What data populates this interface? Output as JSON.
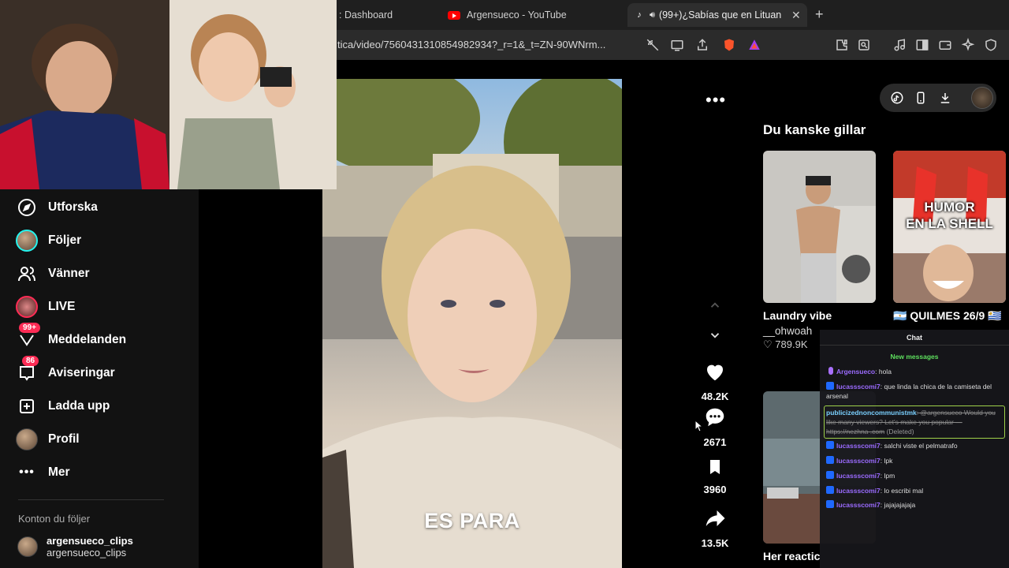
{
  "browser": {
    "tabs": [
      {
        "label": ": Dashboard",
        "active": false
      },
      {
        "label": "Argensueco - YouTube",
        "active": false,
        "icon": "youtube-icon"
      },
      {
        "label": "(99+)¿Sabías que en Lituan",
        "active": true,
        "icon": "tiktok-icon"
      }
    ],
    "url": "tica/video/7560431310854982934?_r=1&_t=ZN-90WNrm..."
  },
  "sidebar": {
    "items": [
      {
        "label": "Utforska",
        "icon": "compass-icon"
      },
      {
        "label": "Följer",
        "icon": "following-avatar"
      },
      {
        "label": "Vänner",
        "icon": "friends-icon"
      },
      {
        "label": "LIVE",
        "icon": "live-avatar"
      },
      {
        "label": "Meddelanden",
        "icon": "inbox-icon",
        "badge": "99+"
      },
      {
        "label": "Aviseringar",
        "icon": "notifications-icon",
        "badge": "86"
      },
      {
        "label": "Ladda upp",
        "icon": "upload-icon"
      },
      {
        "label": "Profil",
        "icon": "profile-avatar"
      },
      {
        "label": "Mer",
        "icon": "more-icon"
      }
    ],
    "following_title": "Konton du följer",
    "following": [
      {
        "name": "argensueco_clips",
        "handle": "argensueco_clips"
      }
    ]
  },
  "video": {
    "caption": "ES PARA"
  },
  "actions": {
    "likes": "48.2K",
    "comments": "2671",
    "saves": "3960",
    "shares": "13.5K"
  },
  "recommendations": {
    "title": "Du kanske gillar",
    "items": [
      {
        "title": "Laundry vibe",
        "user": "__ohwoah",
        "likes": "789.9K",
        "overlay": ""
      },
      {
        "title": "🇦🇷 QUILMES 26/9 🇺🇾",
        "user": "",
        "likes": "",
        "overlay_lines": [
          "HUMOR",
          "EN LA SHELL"
        ]
      },
      {
        "title": "Her reactic",
        "user": "",
        "likes": "",
        "overlay": ""
      }
    ]
  },
  "chat": {
    "title": "Chat",
    "new_messages": "New messages",
    "messages": [
      {
        "user": "Argensueco",
        "text": ": hola",
        "type": "broadcaster"
      },
      {
        "user": "lucassscomi7",
        "text": ": que linda la chica de la camiseta del arsenal"
      },
      {
        "user": "publicizednoncommunistmk",
        "text": ": @argensueco Would you like many viewers? Let's make you popular — https://nezhna .com",
        "deleted": "(Deleted)",
        "type": "highlight"
      },
      {
        "user": "lucassscomi7",
        "text": ": salchi viste el pelmatrafo"
      },
      {
        "user": "lucassscomi7",
        "text": ": lpk"
      },
      {
        "user": "lucassscomi7",
        "text": ": lpm"
      },
      {
        "user": "lucassscomi7",
        "text": ": lo escribi mal"
      },
      {
        "user": "lucassscomi7",
        "text": ": jajajajajaja"
      }
    ]
  },
  "colors": {
    "accent": "#fe2c55",
    "chat_user": "#9b6bff",
    "new_messages": "#5ee05e"
  }
}
